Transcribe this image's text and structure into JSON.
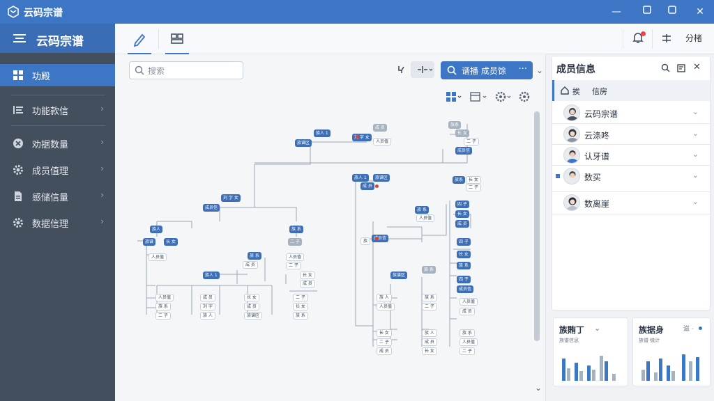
{
  "app": {
    "title": "云码宗谱"
  },
  "window": {
    "minimize": "—",
    "maximize": "▢",
    "close": "✕"
  },
  "sidebar": {
    "title": "云码宗谱",
    "items": [
      {
        "label": "功殿",
        "active": true
      },
      {
        "label": "功能款信"
      },
      {
        "label": "劝据数量"
      },
      {
        "label": "成员值理"
      },
      {
        "label": "感储信量"
      },
      {
        "label": "数据信理"
      }
    ]
  },
  "toolstrip": {
    "right_action": "分楮"
  },
  "canvas": {
    "search_placeholder": "搜索",
    "primary_button": "谱播  成员馀",
    "primary_more": "···",
    "nodes": [
      "族人 1",
      "族谱区",
      "刘 字 女",
      "成 员",
      "人员值",
      "族系",
      "长 女",
      "二 子",
      "成员信",
      "四 子"
    ]
  },
  "right_panel": {
    "title": "成员信息",
    "tabs": [
      "挨",
      "信房"
    ],
    "members": [
      {
        "name": "云码宗谱"
      },
      {
        "name": "云涤咚"
      },
      {
        "name": "认牙谱"
      },
      {
        "name": "数买"
      },
      {
        "name": "数离崖"
      }
    ],
    "mini_cards": [
      {
        "title": "族賄丁",
        "subtitle": "族谱信息",
        "control": "⌄"
      },
      {
        "title": "族据身",
        "subtitle": "族谱 统计",
        "control": "滋 ·"
      }
    ]
  },
  "colors": {
    "accent": "#3c76c4",
    "sidebar": "#444f5e",
    "alert": "#e44444"
  }
}
